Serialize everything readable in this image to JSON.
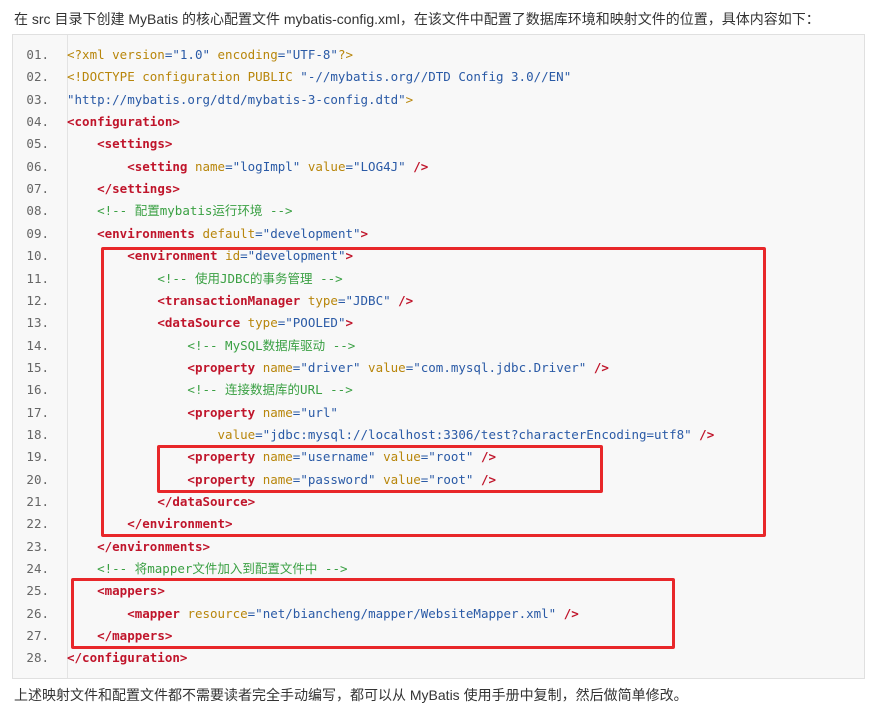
{
  "intro": "在 src 目录下创建 MyBatis 的核心配置文件 mybatis-config.xml，在该文件中配置了数据库环境和映射文件的位置，具体内容如下：",
  "outro": "上述映射文件和配置文件都不需要读者完全手动编写，都可以从 MyBatis 使用手册中复制，然后做简单修改。",
  "lines": [
    {
      "n": "01.",
      "segs": [
        [
          "decl",
          "<?xml "
        ],
        [
          "attr",
          "version"
        ],
        [
          "val",
          "=\"1.0\""
        ],
        [
          "attr",
          " encoding"
        ],
        [
          "val",
          "=\"UTF-8\""
        ],
        [
          "decl",
          "?>"
        ]
      ]
    },
    {
      "n": "02.",
      "segs": [
        [
          "decl",
          "<!DOCTYPE configuration PUBLIC "
        ],
        [
          "val",
          "\"-//mybatis.org//DTD Config 3.0//EN\""
        ]
      ]
    },
    {
      "n": "03.",
      "segs": [
        [
          "val",
          "\"http://mybatis.org/dtd/mybatis-3-config.dtd\""
        ],
        [
          "decl",
          ">"
        ]
      ]
    },
    {
      "n": "04.",
      "segs": [
        [
          "tag",
          "<configuration>"
        ]
      ]
    },
    {
      "n": "05.",
      "segs": [
        [
          "plain",
          "    "
        ],
        [
          "tag",
          "<settings>"
        ]
      ]
    },
    {
      "n": "06.",
      "segs": [
        [
          "plain",
          "        "
        ],
        [
          "tag",
          "<setting "
        ],
        [
          "attr",
          "name"
        ],
        [
          "val",
          "=\"logImpl\""
        ],
        [
          "attr",
          " value"
        ],
        [
          "val",
          "=\"LOG4J\""
        ],
        [
          "tag",
          " />"
        ]
      ]
    },
    {
      "n": "07.",
      "segs": [
        [
          "plain",
          "    "
        ],
        [
          "tag",
          "</settings>"
        ]
      ]
    },
    {
      "n": "08.",
      "segs": [
        [
          "plain",
          "    "
        ],
        [
          "cmt",
          "<!-- 配置mybatis运行环境 -->"
        ]
      ]
    },
    {
      "n": "09.",
      "segs": [
        [
          "plain",
          "    "
        ],
        [
          "tag",
          "<environments "
        ],
        [
          "attr",
          "default"
        ],
        [
          "val",
          "=\"development\""
        ],
        [
          "tag",
          ">"
        ]
      ]
    },
    {
      "n": "10.",
      "segs": [
        [
          "plain",
          "        "
        ],
        [
          "tag",
          "<environment "
        ],
        [
          "attr",
          "id"
        ],
        [
          "val",
          "=\"development\""
        ],
        [
          "tag",
          ">"
        ]
      ]
    },
    {
      "n": "11.",
      "segs": [
        [
          "plain",
          "            "
        ],
        [
          "cmt",
          "<!-- 使用JDBC的事务管理 -->"
        ]
      ]
    },
    {
      "n": "12.",
      "segs": [
        [
          "plain",
          "            "
        ],
        [
          "tag",
          "<transactionManager "
        ],
        [
          "attr",
          "type"
        ],
        [
          "val",
          "=\"JDBC\""
        ],
        [
          "tag",
          " />"
        ]
      ]
    },
    {
      "n": "13.",
      "segs": [
        [
          "plain",
          "            "
        ],
        [
          "tag",
          "<dataSource "
        ],
        [
          "attr",
          "type"
        ],
        [
          "val",
          "=\"POOLED\""
        ],
        [
          "tag",
          ">"
        ]
      ]
    },
    {
      "n": "14.",
      "segs": [
        [
          "plain",
          "                "
        ],
        [
          "cmt",
          "<!-- MySQL数据库驱动 -->"
        ]
      ]
    },
    {
      "n": "15.",
      "segs": [
        [
          "plain",
          "                "
        ],
        [
          "tag",
          "<property "
        ],
        [
          "attr",
          "name"
        ],
        [
          "val",
          "=\"driver\""
        ],
        [
          "attr",
          " value"
        ],
        [
          "val",
          "=\"com.mysql.jdbc.Driver\""
        ],
        [
          "tag",
          " />"
        ]
      ]
    },
    {
      "n": "16.",
      "segs": [
        [
          "plain",
          "                "
        ],
        [
          "cmt",
          "<!-- 连接数据库的URL -->"
        ]
      ]
    },
    {
      "n": "17.",
      "segs": [
        [
          "plain",
          "                "
        ],
        [
          "tag",
          "<property "
        ],
        [
          "attr",
          "name"
        ],
        [
          "val",
          "=\"url\""
        ]
      ]
    },
    {
      "n": "18.",
      "segs": [
        [
          "plain",
          "                    "
        ],
        [
          "attr",
          "value"
        ],
        [
          "val",
          "=\"jdbc:mysql://localhost:3306/test?characterEncoding=utf8\""
        ],
        [
          "tag",
          " />"
        ]
      ]
    },
    {
      "n": "19.",
      "segs": [
        [
          "plain",
          "                "
        ],
        [
          "tag",
          "<property "
        ],
        [
          "attr",
          "name"
        ],
        [
          "val",
          "=\"username\""
        ],
        [
          "attr",
          " value"
        ],
        [
          "val",
          "=\"root\""
        ],
        [
          "tag",
          " />"
        ]
      ]
    },
    {
      "n": "20.",
      "segs": [
        [
          "plain",
          "                "
        ],
        [
          "tag",
          "<property "
        ],
        [
          "attr",
          "name"
        ],
        [
          "val",
          "=\"password\""
        ],
        [
          "attr",
          " value"
        ],
        [
          "val",
          "=\"root\""
        ],
        [
          "tag",
          " />"
        ]
      ]
    },
    {
      "n": "21.",
      "segs": [
        [
          "plain",
          "            "
        ],
        [
          "tag",
          "</dataSource>"
        ]
      ]
    },
    {
      "n": "22.",
      "segs": [
        [
          "plain",
          "        "
        ],
        [
          "tag",
          "</environment>"
        ]
      ]
    },
    {
      "n": "23.",
      "segs": [
        [
          "plain",
          "    "
        ],
        [
          "tag",
          "</environments>"
        ]
      ]
    },
    {
      "n": "24.",
      "segs": [
        [
          "plain",
          "    "
        ],
        [
          "cmt",
          "<!-- 将mapper文件加入到配置文件中 -->"
        ]
      ]
    },
    {
      "n": "25.",
      "segs": [
        [
          "plain",
          "    "
        ],
        [
          "tag",
          "<mappers>"
        ]
      ]
    },
    {
      "n": "26.",
      "segs": [
        [
          "plain",
          "        "
        ],
        [
          "tag",
          "<mapper "
        ],
        [
          "attr",
          "resource"
        ],
        [
          "val",
          "=\"net/biancheng/mapper/WebsiteMapper.xml\""
        ],
        [
          "tag",
          " />"
        ]
      ]
    },
    {
      "n": "27.",
      "segs": [
        [
          "plain",
          "    "
        ],
        [
          "tag",
          "</mappers>"
        ]
      ]
    },
    {
      "n": "28.",
      "segs": [
        [
          "tag",
          "</configuration>"
        ]
      ]
    }
  ],
  "highlight_color": "#e8272a"
}
